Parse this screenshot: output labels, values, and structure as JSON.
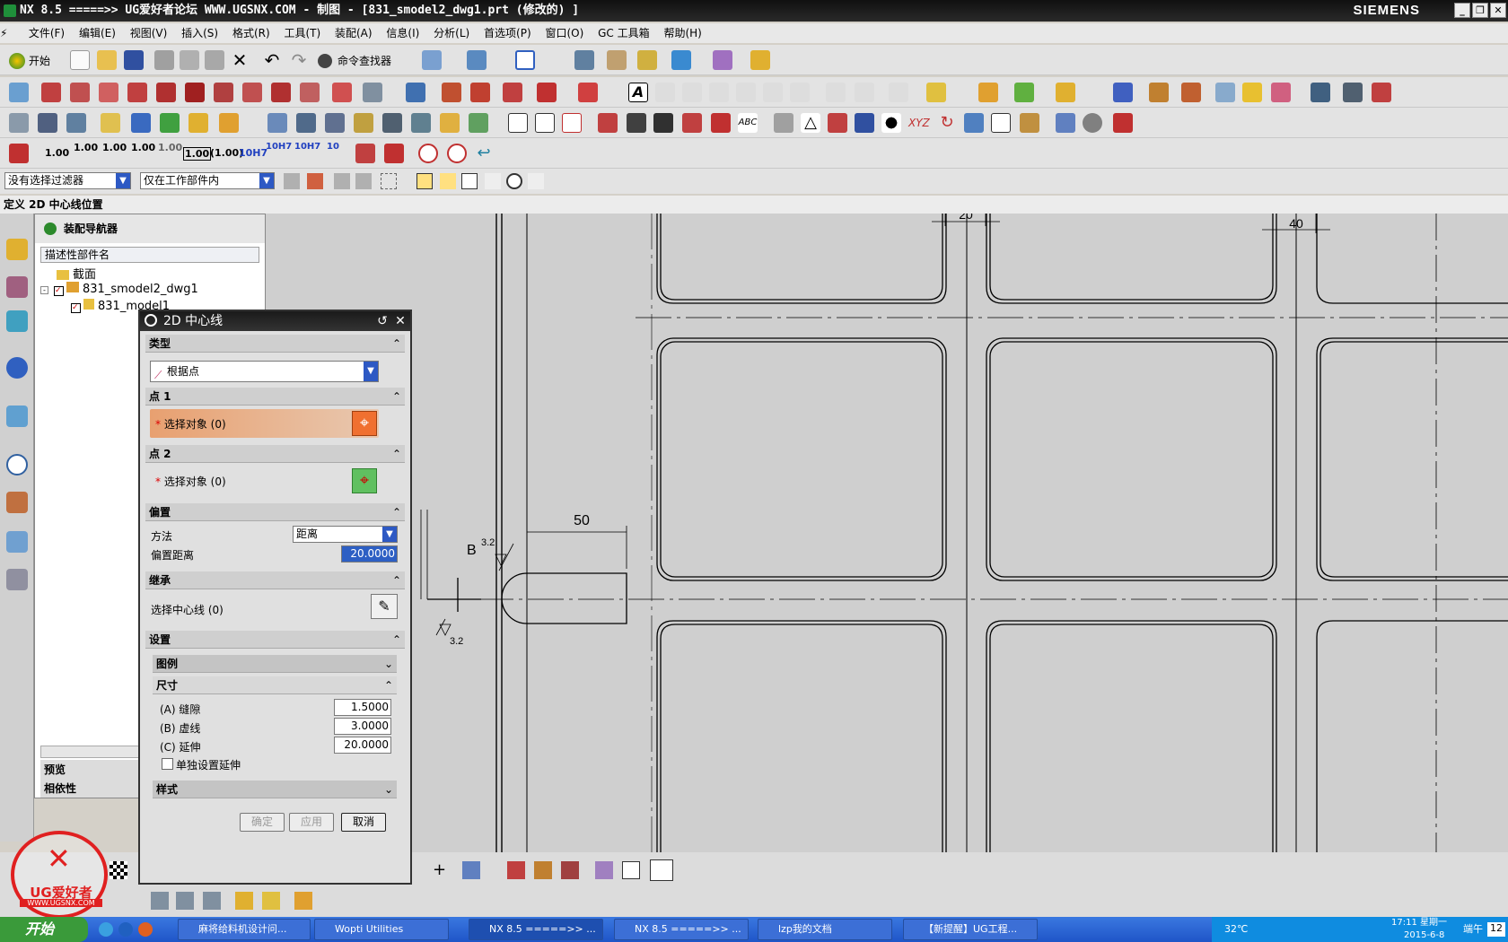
{
  "window": {
    "title": "NX 8.5  =====>>  UG爱好者论坛  WWW.UGSNX.COM - 制图 - [831_smodel2_dwg1.prt  (修改的) ]",
    "brand": "SIEMENS"
  },
  "menu": [
    "文件(F)",
    "编辑(E)",
    "视图(V)",
    "插入(S)",
    "格式(R)",
    "工具(T)",
    "装配(A)",
    "信息(I)",
    "分析(L)",
    "首选项(P)",
    "窗口(O)",
    "GC 工具箱",
    "帮助(H)"
  ],
  "toolbar": {
    "start_label": "开始",
    "command_finder": "命令查找器"
  },
  "dimension_toolbar": [
    "1.00",
    "1.00",
    "1.00",
    "1.00",
    "1.00",
    "1.00",
    "(1.00)",
    "10H7",
    "10H7",
    "10H7",
    "10"
  ],
  "filter": {
    "selection_filter": "没有选择过滤器",
    "scope": "仅在工作部件内"
  },
  "cue_line": "定义 2D 中心线位置",
  "navigator": {
    "title": "装配导航器",
    "column": "描述性部件名",
    "items": [
      "截面",
      "831_smodel2_dwg1",
      "831_model1"
    ],
    "preview": "预览",
    "dependency": "相依性"
  },
  "dialog": {
    "title": "2D 中心线",
    "type_section": "类型",
    "type_value": "根据点",
    "point1_section": "点 1",
    "point1_select": "选择对象 (0)",
    "point2_section": "点 2",
    "point2_select": "选择对象 (0)",
    "offset_section": "偏置",
    "method_label": "方法",
    "method_value": "距离",
    "offset_label": "偏置距离",
    "offset_value": "20.0000",
    "inherit_section": "继承",
    "inherit_select": "选择中心线 (0)",
    "settings_section": "设置",
    "legend_sub": "图例",
    "size_sub": "尺寸",
    "gap_label": "(A) 缝隙",
    "gap_value": "1.5000",
    "dash_label": "(B) 虚线",
    "dash_value": "3.0000",
    "ext_label": "(C) 延伸",
    "ext_value": "20.0000",
    "individual_ext": "单独设置延伸",
    "style_sub": "样式",
    "ok": "确定",
    "apply": "应用",
    "cancel": "取消"
  },
  "drawing": {
    "dim_50": "50",
    "dim_40": "40",
    "dim_20": "20",
    "label_B": "B",
    "rough1": "3.2",
    "rough2": "3.2"
  },
  "taskbar": {
    "start": "开始",
    "tasks": [
      "麻将给料机设计问...",
      "Wopti Utilities",
      "NX 8.5  =====>> ...",
      "NX 8.5  =====>> ...",
      "lzp我的文档",
      "【新提醒】UG工程..."
    ],
    "temp": "32℃",
    "time": "17:11 星期一",
    "date": "2015-6-8",
    "ime": "端午",
    "ime_num": "12"
  },
  "logo": {
    "text": "UG爱好者",
    "url": "WWW.UGSNX.COM"
  }
}
